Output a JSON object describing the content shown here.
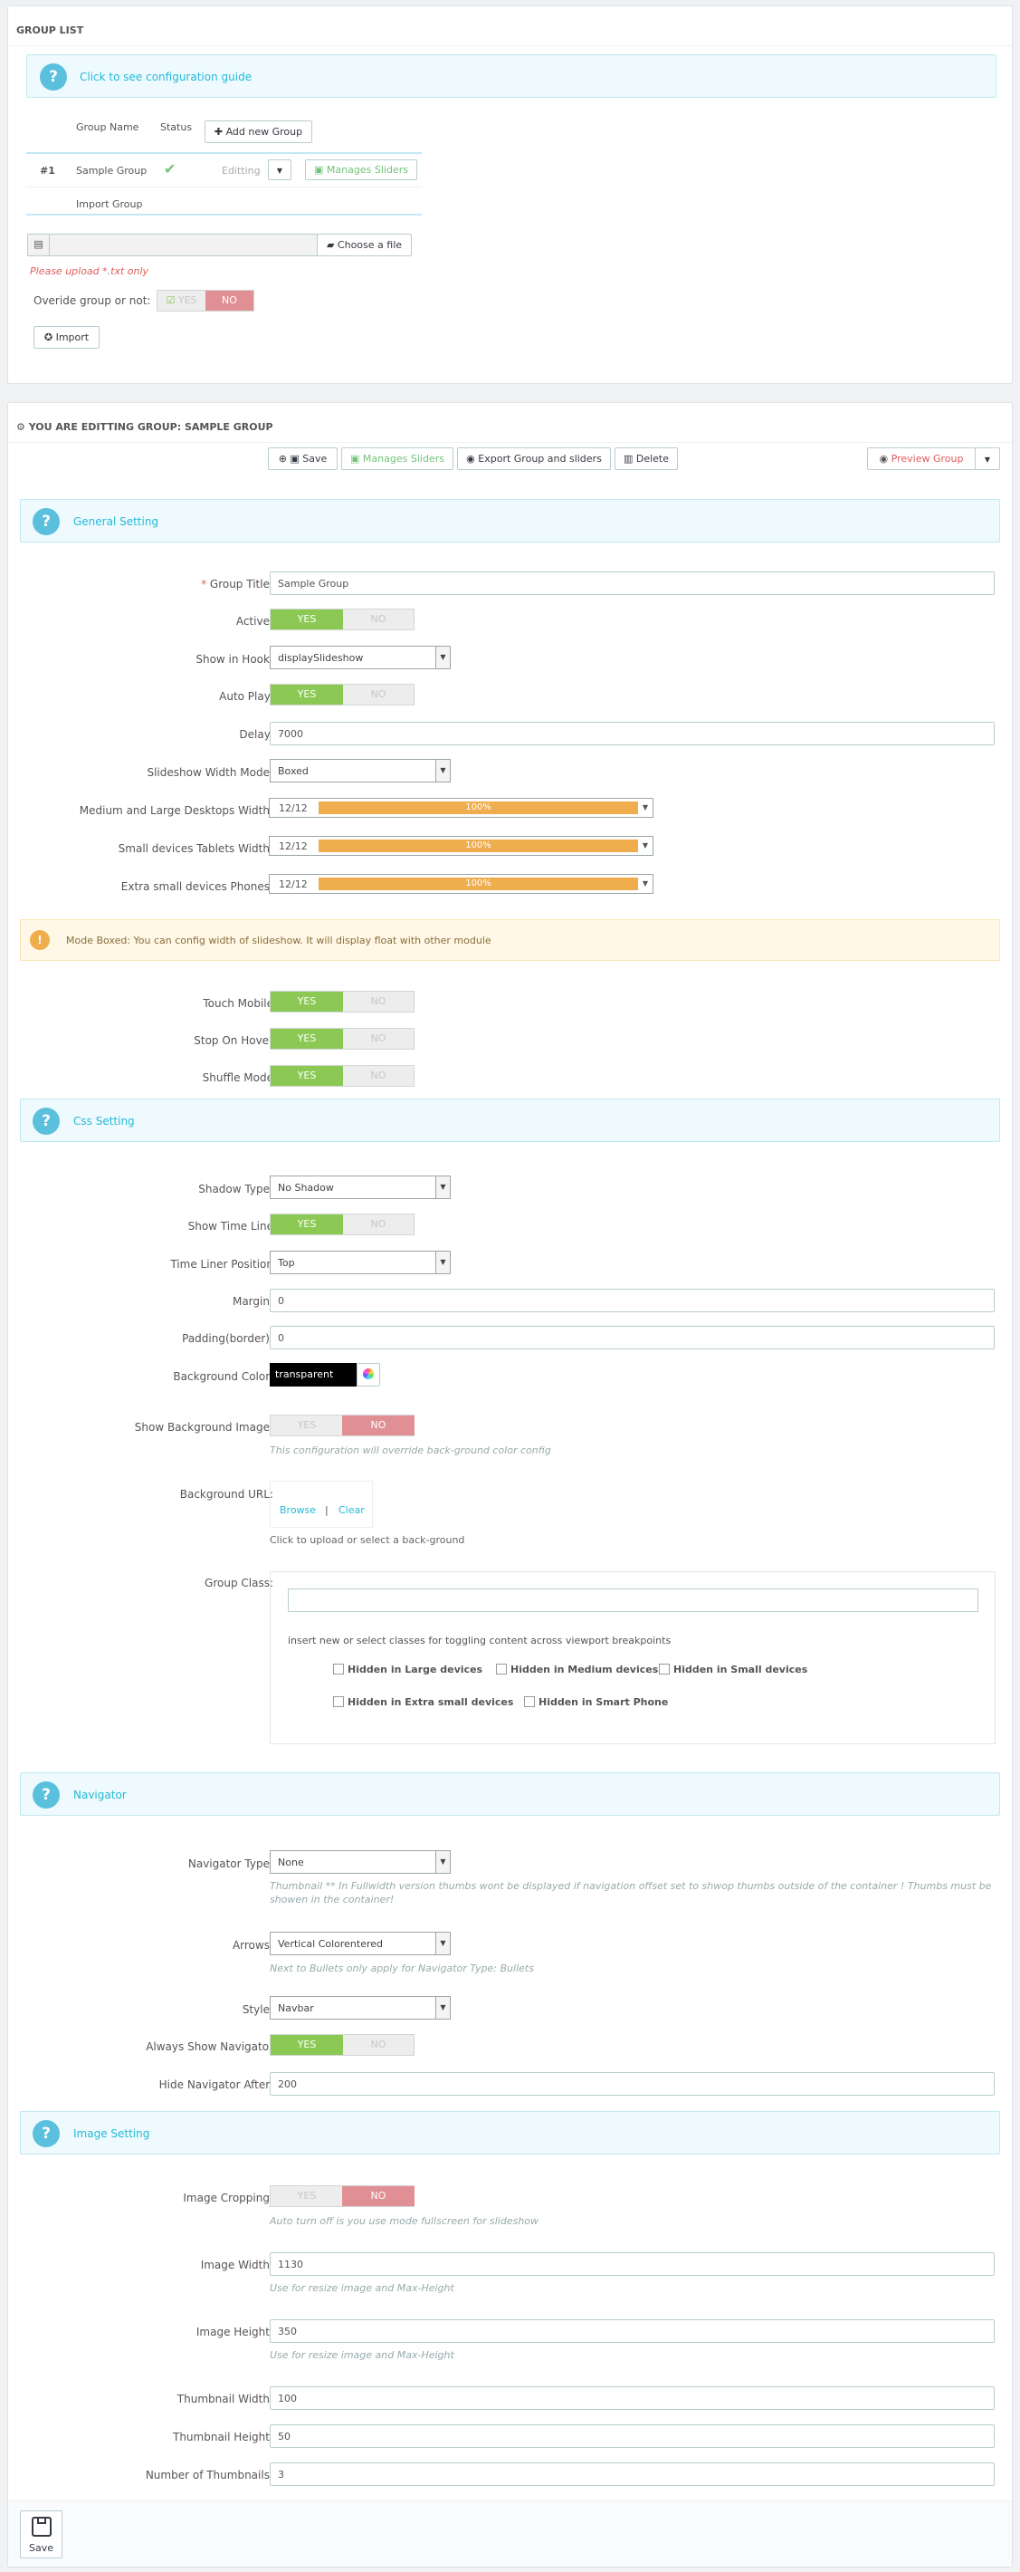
{
  "group_list": {
    "title": "GROUP LIST",
    "guide": "Click to see configuration guide",
    "col_name": "Group Name",
    "col_status": "Status",
    "add_btn": "Add new Group",
    "row": {
      "num": "#1",
      "name": "Sample Group",
      "editing": "Editting",
      "manage": "Manages Sliders"
    },
    "import_group": "Import Group",
    "choose": "Choose a file",
    "upload_note": "Please upload *.txt only",
    "override": "Overide group or not:",
    "yes": "YES",
    "no": "NO",
    "import_btn": "Import"
  },
  "edit": {
    "title": "YOU ARE EDITTING GROUP: SAMPLE GROUP",
    "toolbar": {
      "save": "Save",
      "manage": "Manages Sliders",
      "export": "Export Group and sliders",
      "delete": "Delete",
      "preview": "Preview Group"
    }
  },
  "sections": {
    "general": "General Setting",
    "css": "Css Setting",
    "navigator": "Navigator",
    "image": "Image Setting"
  },
  "toggle": {
    "yes": "YES",
    "no": "NO"
  },
  "general": {
    "group_title_label": "Group Title:",
    "group_title": "Sample Group",
    "active_label": "Active:",
    "hook_label": "Show in Hook:",
    "hook": "displaySlideshow",
    "autoplay_label": "Auto Play:",
    "delay_label": "Delay:",
    "delay": "7000",
    "width_mode_label": "Slideshow Width Mode:",
    "width_mode": "Boxed",
    "md_label": "Medium and Large Desktops Width:",
    "sm_label": "Small devices Tablets Width:",
    "xs_label": "Extra small devices Phones:",
    "ratio": "12/12",
    "ratio_pct": "100%",
    "ratio_fill": 1.0,
    "warn": "Mode Boxed: You can config width of slideshow. It will display float with other module",
    "touch_label": "Touch Mobile",
    "hover_label": "Stop On Hover",
    "shuffle_label": "Shuffle Mode"
  },
  "css": {
    "shadow_label": "Shadow Type:",
    "shadow": "No Shadow",
    "timeline_label": "Show Time Line",
    "timeline_pos_label": "Time Liner Position",
    "timeline_pos": "Top",
    "margin_label": "Margin:",
    "margin": "0",
    "padding_label": "Padding(border):",
    "padding": "0",
    "bg_color_label": "Background Color:",
    "bg_color": "transparent",
    "bg_image_label": "Show Background Image:",
    "bg_image_hint": "This configuration will override back-ground color config",
    "bg_url_label": "Background URL:",
    "browse": "Browse",
    "sep": "|",
    "clear": "Clear",
    "bg_url_hint": "Click to upload or select a back-ground",
    "class_label": "Group Class:",
    "class_hint": "insert new or select classes for toggling content across viewport breakpoints",
    "hidden_lg": "Hidden in Large devices",
    "hidden_md": "Hidden in Medium devices",
    "hidden_sm": "Hidden in Small devices",
    "hidden_xs": "Hidden in Extra small devices",
    "hidden_sp": "Hidden in Smart Phone"
  },
  "nav": {
    "type_label": "Navigator Type:",
    "type": "None",
    "type_hint": "Thumbnail ** In Fullwidth version thumbs wont be displayed if navigation offset set to shwop thumbs outside of the container ! Thumbs must be showen in the container!",
    "arrows_label": "Arrows:",
    "arrows": "Vertical Colorentered",
    "arrows_hint": "Next to Bullets only apply for Navigator Type: Bullets",
    "style_label": "Style:",
    "style": "Navbar",
    "always_label": "Always Show Navigator",
    "hide_label": "Hide Navigator After:",
    "hide": "200"
  },
  "image": {
    "crop_label": "Image Cropping:",
    "crop_hint": "Auto turn off is you use mode fullscreen for slideshow",
    "width_label": "Image Width:",
    "width": "1130",
    "width_hint": "Use for resize image and Max-Height",
    "height_label": "Image Height:",
    "height": "350",
    "height_hint": "Use for resize image and Max-Height",
    "thumb_w_label": "Thumbnail Width:",
    "thumb_w": "100",
    "thumb_h_label": "Thumbnail Height:",
    "thumb_h": "50",
    "thumb_n_label": "Number of Thumbnails:",
    "thumb_n": "3"
  },
  "footer": {
    "save": "Save"
  },
  "colors": {
    "accent": "#25b9d7",
    "yes": "#8bc954",
    "no": "#e08f95",
    "progress": "#f0ad4e",
    "warn_bg": "#fff8e6",
    "manage": "#72c279",
    "error": "#e05b5b"
  }
}
